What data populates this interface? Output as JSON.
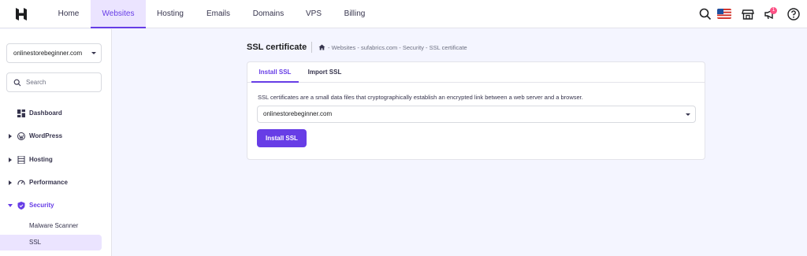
{
  "nav": {
    "items": [
      {
        "label": "Home",
        "active": false
      },
      {
        "label": "Websites",
        "active": true
      },
      {
        "label": "Hosting",
        "active": false
      },
      {
        "label": "Emails",
        "active": false
      },
      {
        "label": "Domains",
        "active": false
      },
      {
        "label": "VPS",
        "active": false
      },
      {
        "label": "Billing",
        "active": false
      }
    ],
    "icons": [
      "search-icon",
      "us-flag-icon",
      "store-icon",
      "megaphone-icon",
      "help-icon"
    ],
    "notification_count": "1"
  },
  "sidebar": {
    "website_selector": "onlinestorebeginner.com",
    "search_placeholder": "Search",
    "items": [
      {
        "label": "Dashboard",
        "icon": "dashboard-icon"
      },
      {
        "label": "WordPress",
        "icon": "wordpress-icon"
      },
      {
        "label": "Hosting",
        "icon": "server-icon"
      },
      {
        "label": "Performance",
        "icon": "gauge-icon"
      },
      {
        "label": "Security",
        "icon": "shield-icon"
      }
    ],
    "sub_items": [
      {
        "label": "Malware Scanner"
      },
      {
        "label": "SSL"
      }
    ]
  },
  "main": {
    "title": "SSL certificate",
    "breadcrumb": "- Websites - sufabrics.com - Security - SSL certificate",
    "tabs": [
      {
        "label": "Install SSL"
      },
      {
        "label": "Import SSL"
      }
    ],
    "description": "SSL certificates are a small data files that cryptographically establish an encrypted link between a web server and a browser.",
    "domain_value": "onlinestorebeginner.com",
    "install_button": "Install SSL"
  },
  "colors": {
    "accent": "#673de6",
    "accent_light": "#ebe4ff",
    "background": "#f4f5ff"
  }
}
